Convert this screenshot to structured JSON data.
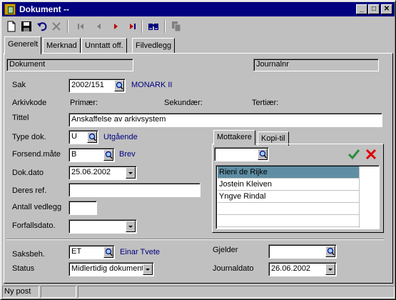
{
  "window": {
    "title": "Dokument  --"
  },
  "titlebar_buttons": {
    "minimize": "_",
    "maximize": "□",
    "close": "✕"
  },
  "toolbar": {
    "icons": [
      "new-document-icon",
      "save-icon",
      "undo-icon",
      "delete-icon",
      "first-record-icon",
      "previous-record-icon",
      "next-record-icon",
      "last-record-icon",
      "search-binoculars-icon",
      "copy-icon"
    ],
    "colors": {
      "red": "#c00000",
      "blue": "#000080",
      "grey": "#808080"
    }
  },
  "tabs": [
    {
      "label": "Generelt",
      "active": true
    },
    {
      "label": "Merknad"
    },
    {
      "label": "Unntatt off."
    },
    {
      "label": "Filvedlegg"
    }
  ],
  "form": {
    "dokument_label": "Dokument",
    "journalnr_label": "Journalnr",
    "sak_label": "Sak",
    "sak_value": "2002/151",
    "sak_link": "MONARK II",
    "arkivkode_label": "Arkivkode",
    "primaer_label": "Primær:",
    "sekundaer_label": "Sekundær:",
    "tertiaer_label": "Tertiær:",
    "tittel_label": "Tittel",
    "tittel_value": "Anskaffelse av arkivsystem",
    "type_label": "Type dok.",
    "type_value": "U",
    "type_link": "Utgående",
    "forsend_label": "Forsend.måte",
    "forsend_value": "B",
    "forsend_link": "Brev",
    "dokdato_label": "Dok.dato",
    "dokdato_value": "25.06.2002",
    "deres_ref_label": "Deres ref.",
    "deres_ref_value": "",
    "antall_label": "Antall vedlegg",
    "antall_value": "",
    "forfall_label": "Forfallsdato.",
    "forfall_value": "",
    "saksbeh_label": "Saksbeh.",
    "saksbeh_value": "ET",
    "saksbeh_link": "Einar Tvete",
    "status_label": "Status",
    "status_value": "Midlertidig dokument",
    "gjelder_label": "Gjelder",
    "gjelder_value": "",
    "journaldato_label": "Journaldato",
    "journaldato_value": "26.06.2002"
  },
  "recipients": {
    "tabs": [
      "Mottakere",
      "Kopi-til"
    ],
    "search_value": "",
    "items": [
      "Rieni de Rijke",
      "Jostein Kleiven",
      "Yngve Rindal"
    ],
    "selected_index": 0,
    "confirm_color": "#2e8b3c",
    "cancel_color": "#e00000"
  },
  "statusbar": {
    "text": "Ny post"
  }
}
